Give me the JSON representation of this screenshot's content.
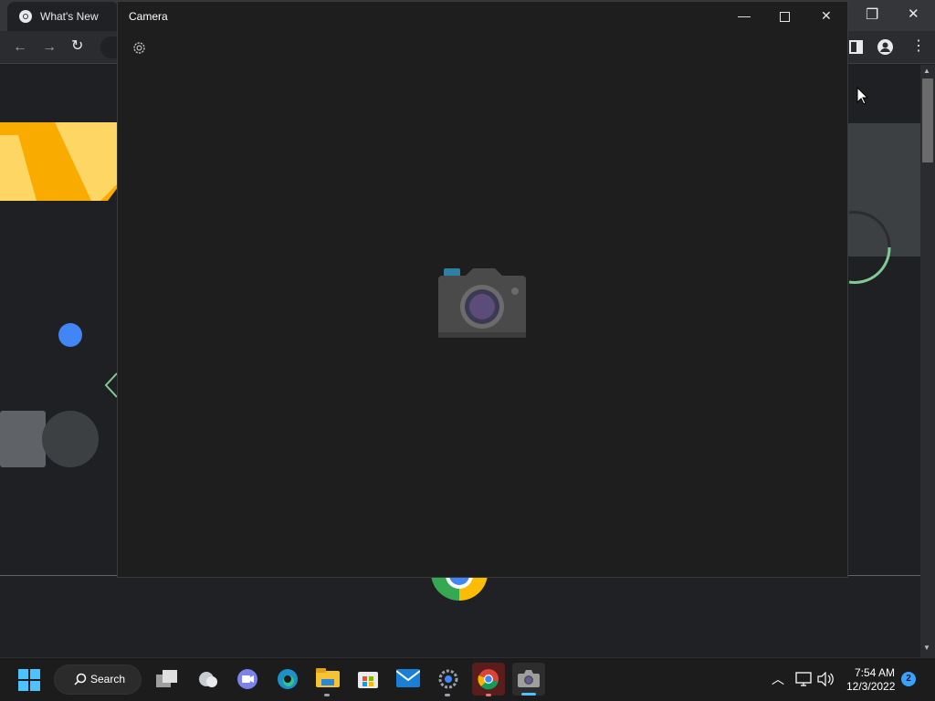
{
  "chrome": {
    "tab_title": "What's New",
    "icons": [
      "chrome-logo-icon",
      "back-icon",
      "forward-icon",
      "reload-icon",
      "side-panel-icon",
      "profile-icon",
      "menu-icon",
      "restore-icon",
      "close-icon"
    ]
  },
  "camera": {
    "title": "Camera",
    "icons": [
      "settings-icon",
      "minimize-icon",
      "maximize-icon",
      "close-icon",
      "camera-placeholder-icon"
    ]
  },
  "taskbar": {
    "search_label": "Search",
    "apps": [
      "start",
      "task-view",
      "weather",
      "teams-chat",
      "edge",
      "file-explorer",
      "microsoft-store",
      "mail",
      "settings",
      "chrome",
      "camera"
    ],
    "clock_time": "7:54 AM",
    "clock_date": "12/3/2022",
    "notification_count": "2"
  },
  "colors": {
    "accent": "#3aa0ff",
    "window_bg": "#1e1e1e",
    "chrome_bg": "#202124",
    "taskbar_bg": "#1c1c1c"
  }
}
